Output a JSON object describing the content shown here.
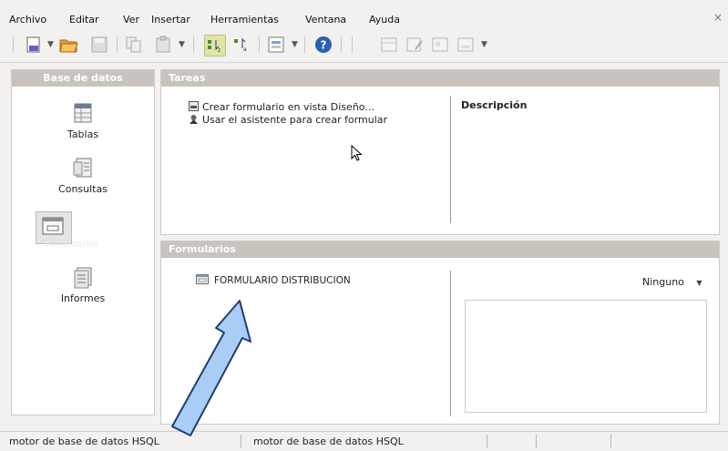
{
  "menu": {
    "items": [
      "Archivo",
      "Editar",
      "Ver",
      "Insertar",
      "Herramientas",
      "Ventana",
      "Ayuda"
    ],
    "close": "×"
  },
  "left_panel": {
    "title": "Base de datos",
    "items": [
      {
        "label": "Tablas",
        "icon": "table-icon"
      },
      {
        "label": "Consultas",
        "icon": "query-icon"
      },
      {
        "label": "Formularios",
        "icon": "form-icon",
        "selected": true
      },
      {
        "label": "Informes",
        "icon": "report-icon"
      }
    ]
  },
  "tasks": {
    "title": "Tareas",
    "items": [
      {
        "label": "Crear formulario en vista Diseño...",
        "icon": "design-view-icon"
      },
      {
        "label": "Usar el asistente para crear formular",
        "icon": "wizard-icon"
      }
    ],
    "description_title": "Descripción"
  },
  "forms": {
    "title": "Formularios",
    "items": [
      {
        "label": "FORMULARIO DISTRIBUCION",
        "icon": "form-doc-icon"
      }
    ],
    "preview_option": "Ninguno"
  },
  "status": {
    "cells": [
      "motor de base de datos HSQL",
      "motor de base de datos HSQL"
    ]
  },
  "colors": {
    "header_bg": "#c8c3bd",
    "arrow_fill": "#a9cdf5",
    "arrow_stroke": "#1f3e70"
  }
}
